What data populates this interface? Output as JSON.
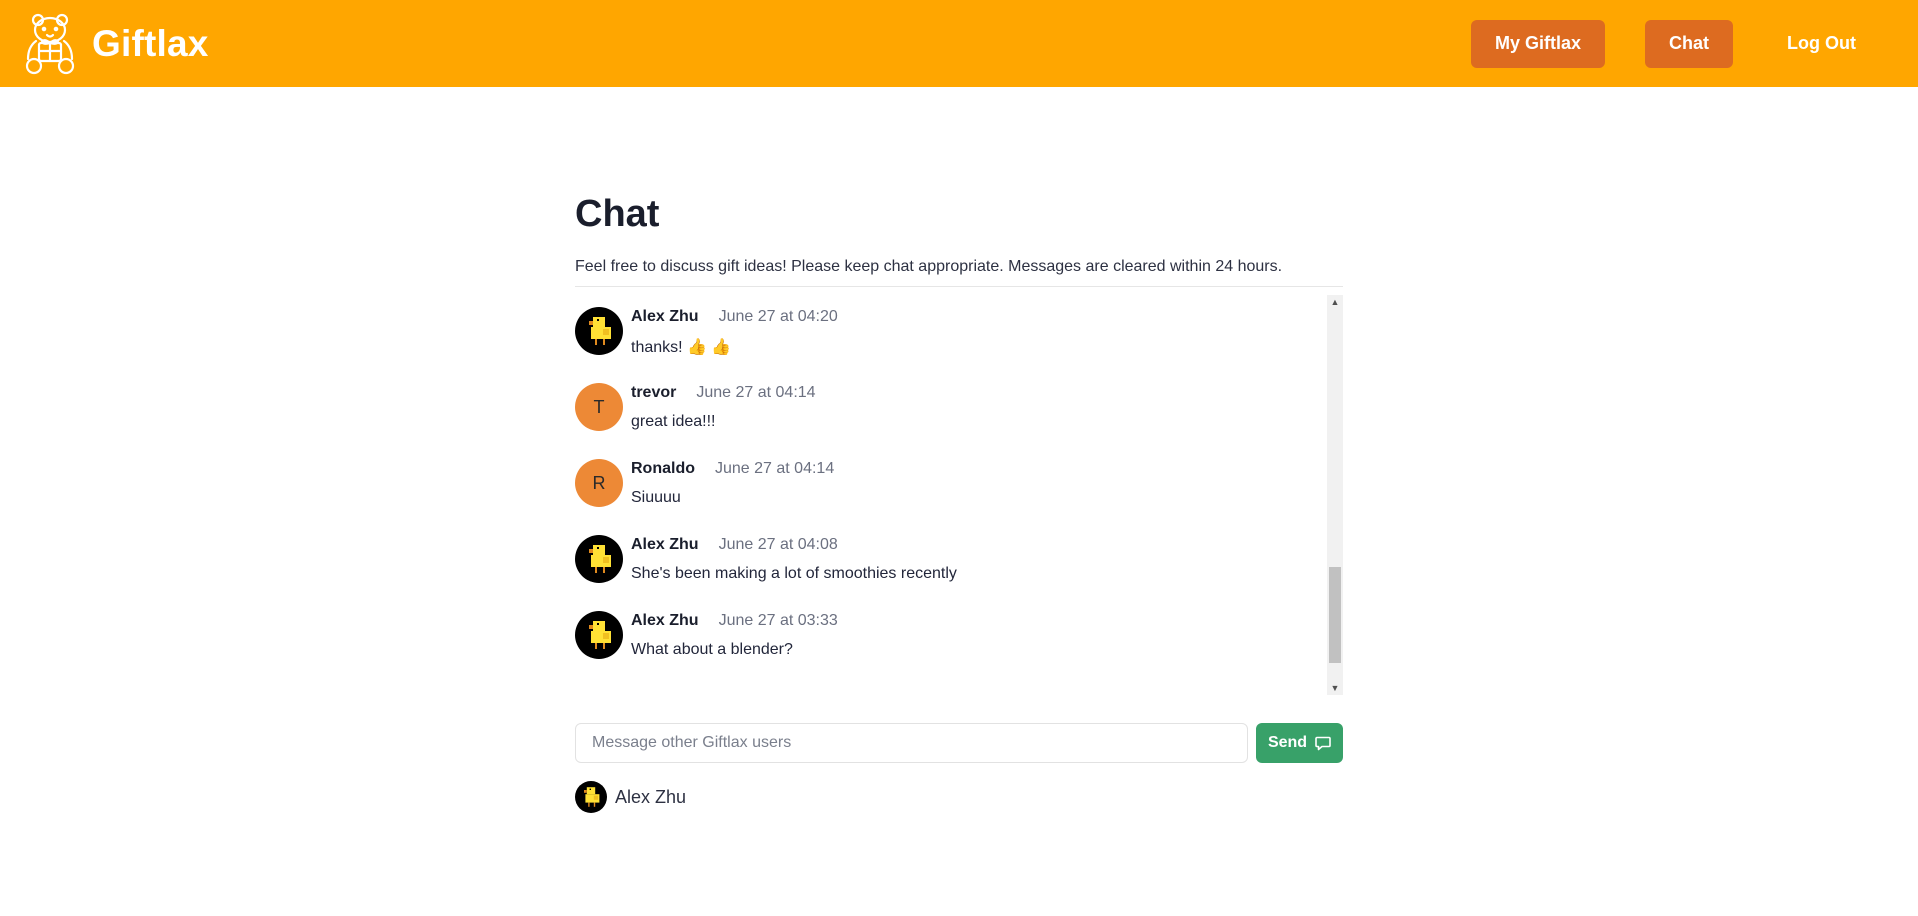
{
  "header": {
    "brand": "Giftlax",
    "nav": {
      "my_giftlax": "My Giftlax",
      "chat": "Chat",
      "logout": "Log Out"
    },
    "accent": "#ffa600",
    "button_color": "#dd6b20"
  },
  "page": {
    "title": "Chat",
    "subtitle": "Feel free to discuss gift ideas! Please keep chat appropriate. Messages are cleared within 24 hours."
  },
  "messages": [
    {
      "name": "Alex Zhu",
      "time": "June 27 at 04:20",
      "text": "thanks! 👍 👍",
      "avatar": "duck"
    },
    {
      "name": "trevor",
      "time": "June 27 at 04:14",
      "text": "great idea!!!",
      "avatar": "T"
    },
    {
      "name": "Ronaldo",
      "time": "June 27 at 04:14",
      "text": "Siuuuu",
      "avatar": "R"
    },
    {
      "name": "Alex Zhu",
      "time": "June 27 at 04:08",
      "text": "She's been making a lot of smoothies recently",
      "avatar": "duck"
    },
    {
      "name": "Alex Zhu",
      "time": "June 27 at 03:33",
      "text": "What about a blender?",
      "avatar": "duck"
    }
  ],
  "composer": {
    "placeholder": "Message other Giftlax users",
    "send_label": "Send",
    "send_color": "#38a169"
  },
  "current_user": {
    "name": "Alex Zhu"
  }
}
